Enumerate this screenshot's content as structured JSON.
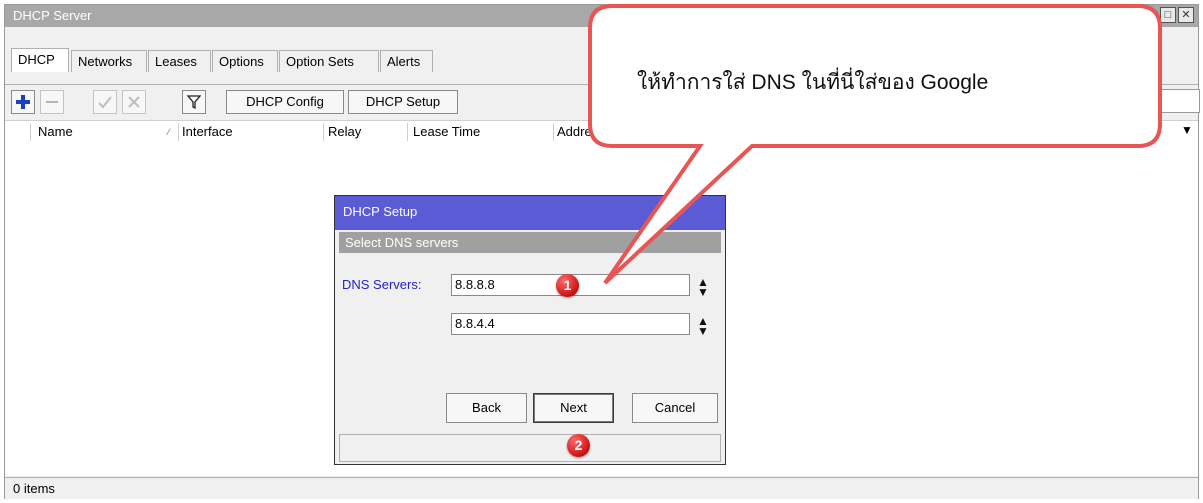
{
  "window": {
    "title": "DHCP Server",
    "controls": [
      "restore-icon",
      "close-icon"
    ]
  },
  "tabs": [
    {
      "label": "DHCP",
      "active": true
    },
    {
      "label": "Networks"
    },
    {
      "label": "Leases"
    },
    {
      "label": "Options"
    },
    {
      "label": "Option Sets"
    },
    {
      "label": "Alerts"
    }
  ],
  "toolbar": {
    "dhcp_config_label": "DHCP Config",
    "dhcp_setup_label": "DHCP Setup",
    "icons": [
      "add-icon",
      "remove-icon",
      "enable-icon",
      "disable-icon",
      "filter-icon"
    ]
  },
  "table": {
    "columns": [
      "Name",
      "Interface",
      "Relay",
      "Lease Time",
      "Addre"
    ]
  },
  "status": {
    "items_label": "0 items"
  },
  "dialog": {
    "title": "DHCP Setup",
    "subtitle": "Select DNS servers",
    "dns_label": "DNS Servers:",
    "dns_servers": [
      "8.8.8.8",
      "8.8.4.4"
    ],
    "back_label": "Back",
    "next_label": "Next",
    "cancel_label": "Cancel"
  },
  "annotation": {
    "callout_text": "ให้ทำการใส่ DNS ในที่นี่ใส่ของ Google",
    "marker1": "1",
    "marker2": "2",
    "accent_color": "#e85555",
    "callout_fill": "#ffffff"
  }
}
